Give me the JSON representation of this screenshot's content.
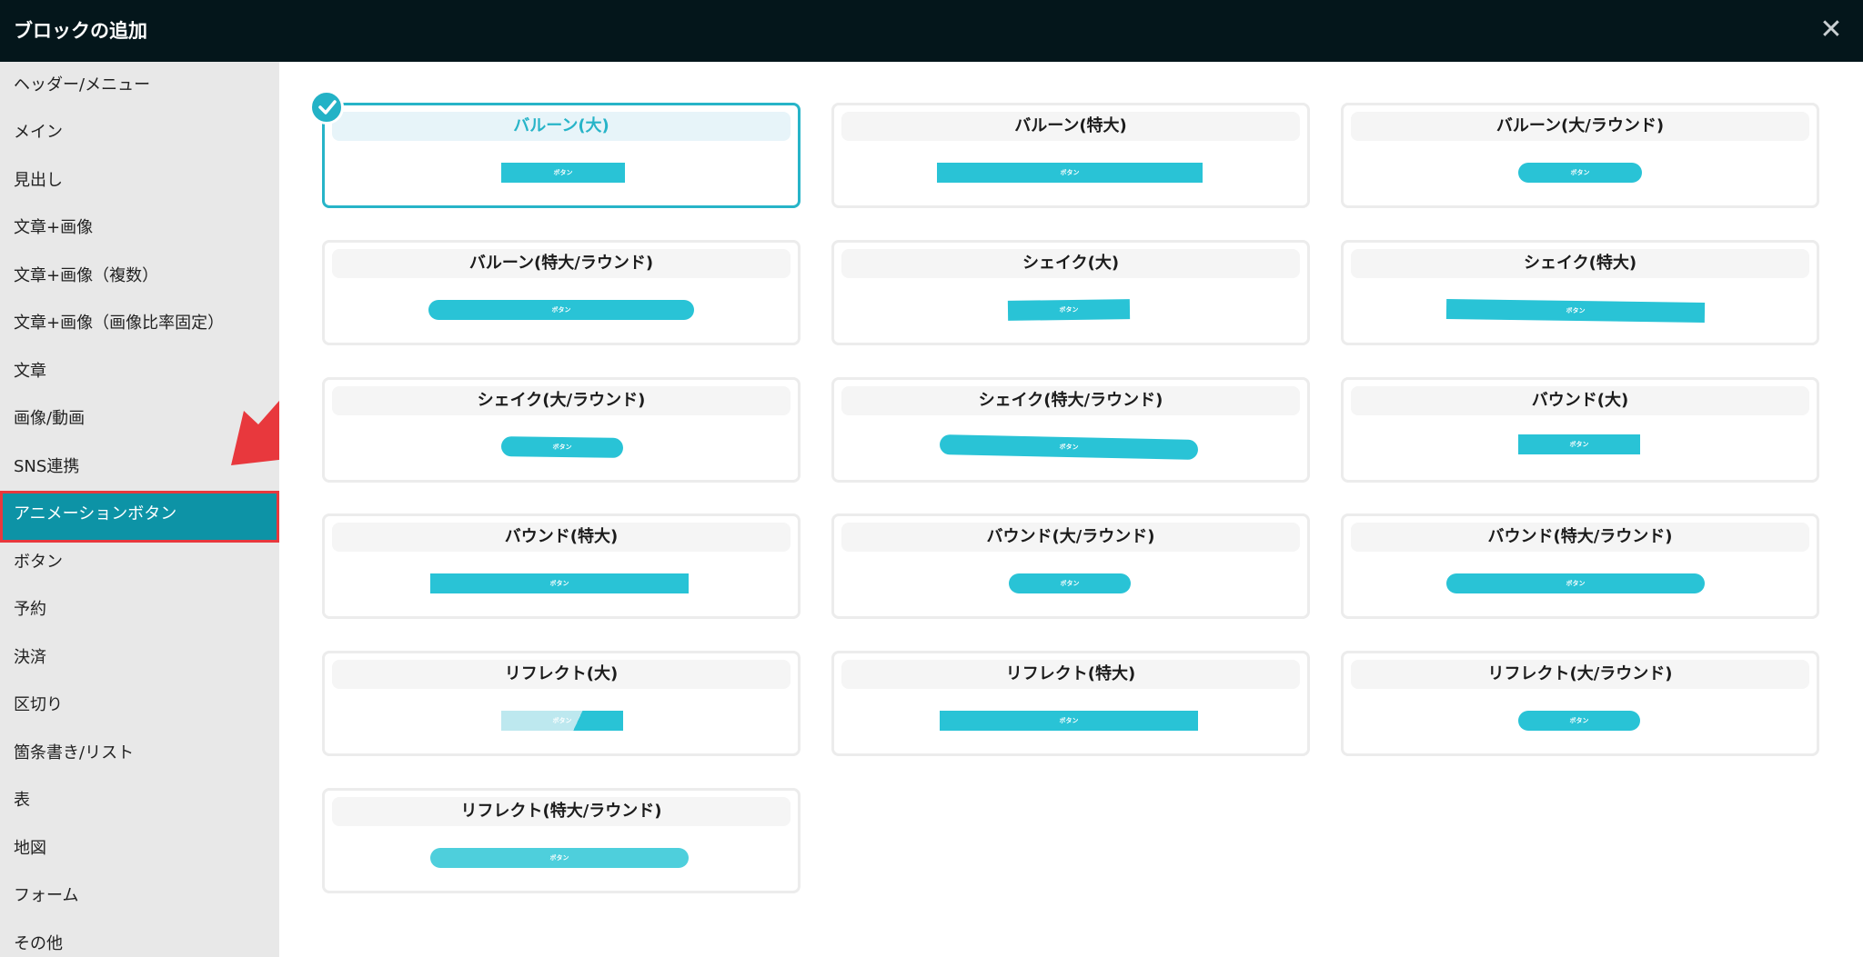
{
  "header": {
    "title": "ブロックの追加",
    "close_label": "✕"
  },
  "sidebar": {
    "items": [
      {
        "label": "ヘッダー/メニュー"
      },
      {
        "label": "メイン"
      },
      {
        "label": "見出し"
      },
      {
        "label": "文章+画像"
      },
      {
        "label": "文章+画像（複数）"
      },
      {
        "label": "文章+画像（画像比率固定）"
      },
      {
        "label": "文章"
      },
      {
        "label": "画像/動画"
      },
      {
        "label": "SNS連携"
      },
      {
        "label": "アニメーションボタン",
        "active": true
      },
      {
        "label": "ボタン"
      },
      {
        "label": "予約"
      },
      {
        "label": "決済"
      },
      {
        "label": "区切り"
      },
      {
        "label": "箇条書き/リスト"
      },
      {
        "label": "表"
      },
      {
        "label": "地図"
      },
      {
        "label": "フォーム"
      },
      {
        "label": "その他"
      }
    ]
  },
  "button_text": "ボタン",
  "cards": [
    {
      "title": "バルーン(大)",
      "selected": true
    },
    {
      "title": "バルーン(特大)"
    },
    {
      "title": "バルーン(大/ラウンド)"
    },
    {
      "title": "バルーン(特大/ラウンド)"
    },
    {
      "title": "シェイク(大)"
    },
    {
      "title": "シェイク(特大)"
    },
    {
      "title": "シェイク(大/ラウンド)"
    },
    {
      "title": "シェイク(特大/ラウンド)"
    },
    {
      "title": "バウンド(大)"
    },
    {
      "title": "バウンド(特大)"
    },
    {
      "title": "バウンド(大/ラウンド)"
    },
    {
      "title": "バウンド(特大/ラウンド)"
    },
    {
      "title": "リフレクト(大)"
    },
    {
      "title": "リフレクト(特大)"
    },
    {
      "title": "リフレクト(大/ラウンド)"
    },
    {
      "title": "リフレクト(特大/ラウンド)"
    }
  ],
  "colors": {
    "header_bg": "#04161b",
    "accent": "#27b4c8",
    "button": "#29c3d6",
    "sidebar_active": "#0d93a6",
    "highlight_border": "#e8383d",
    "arrow": "#e8383d"
  },
  "icons": {
    "close": "close-icon",
    "check": "check-icon",
    "arrow": "arrow-icon"
  }
}
